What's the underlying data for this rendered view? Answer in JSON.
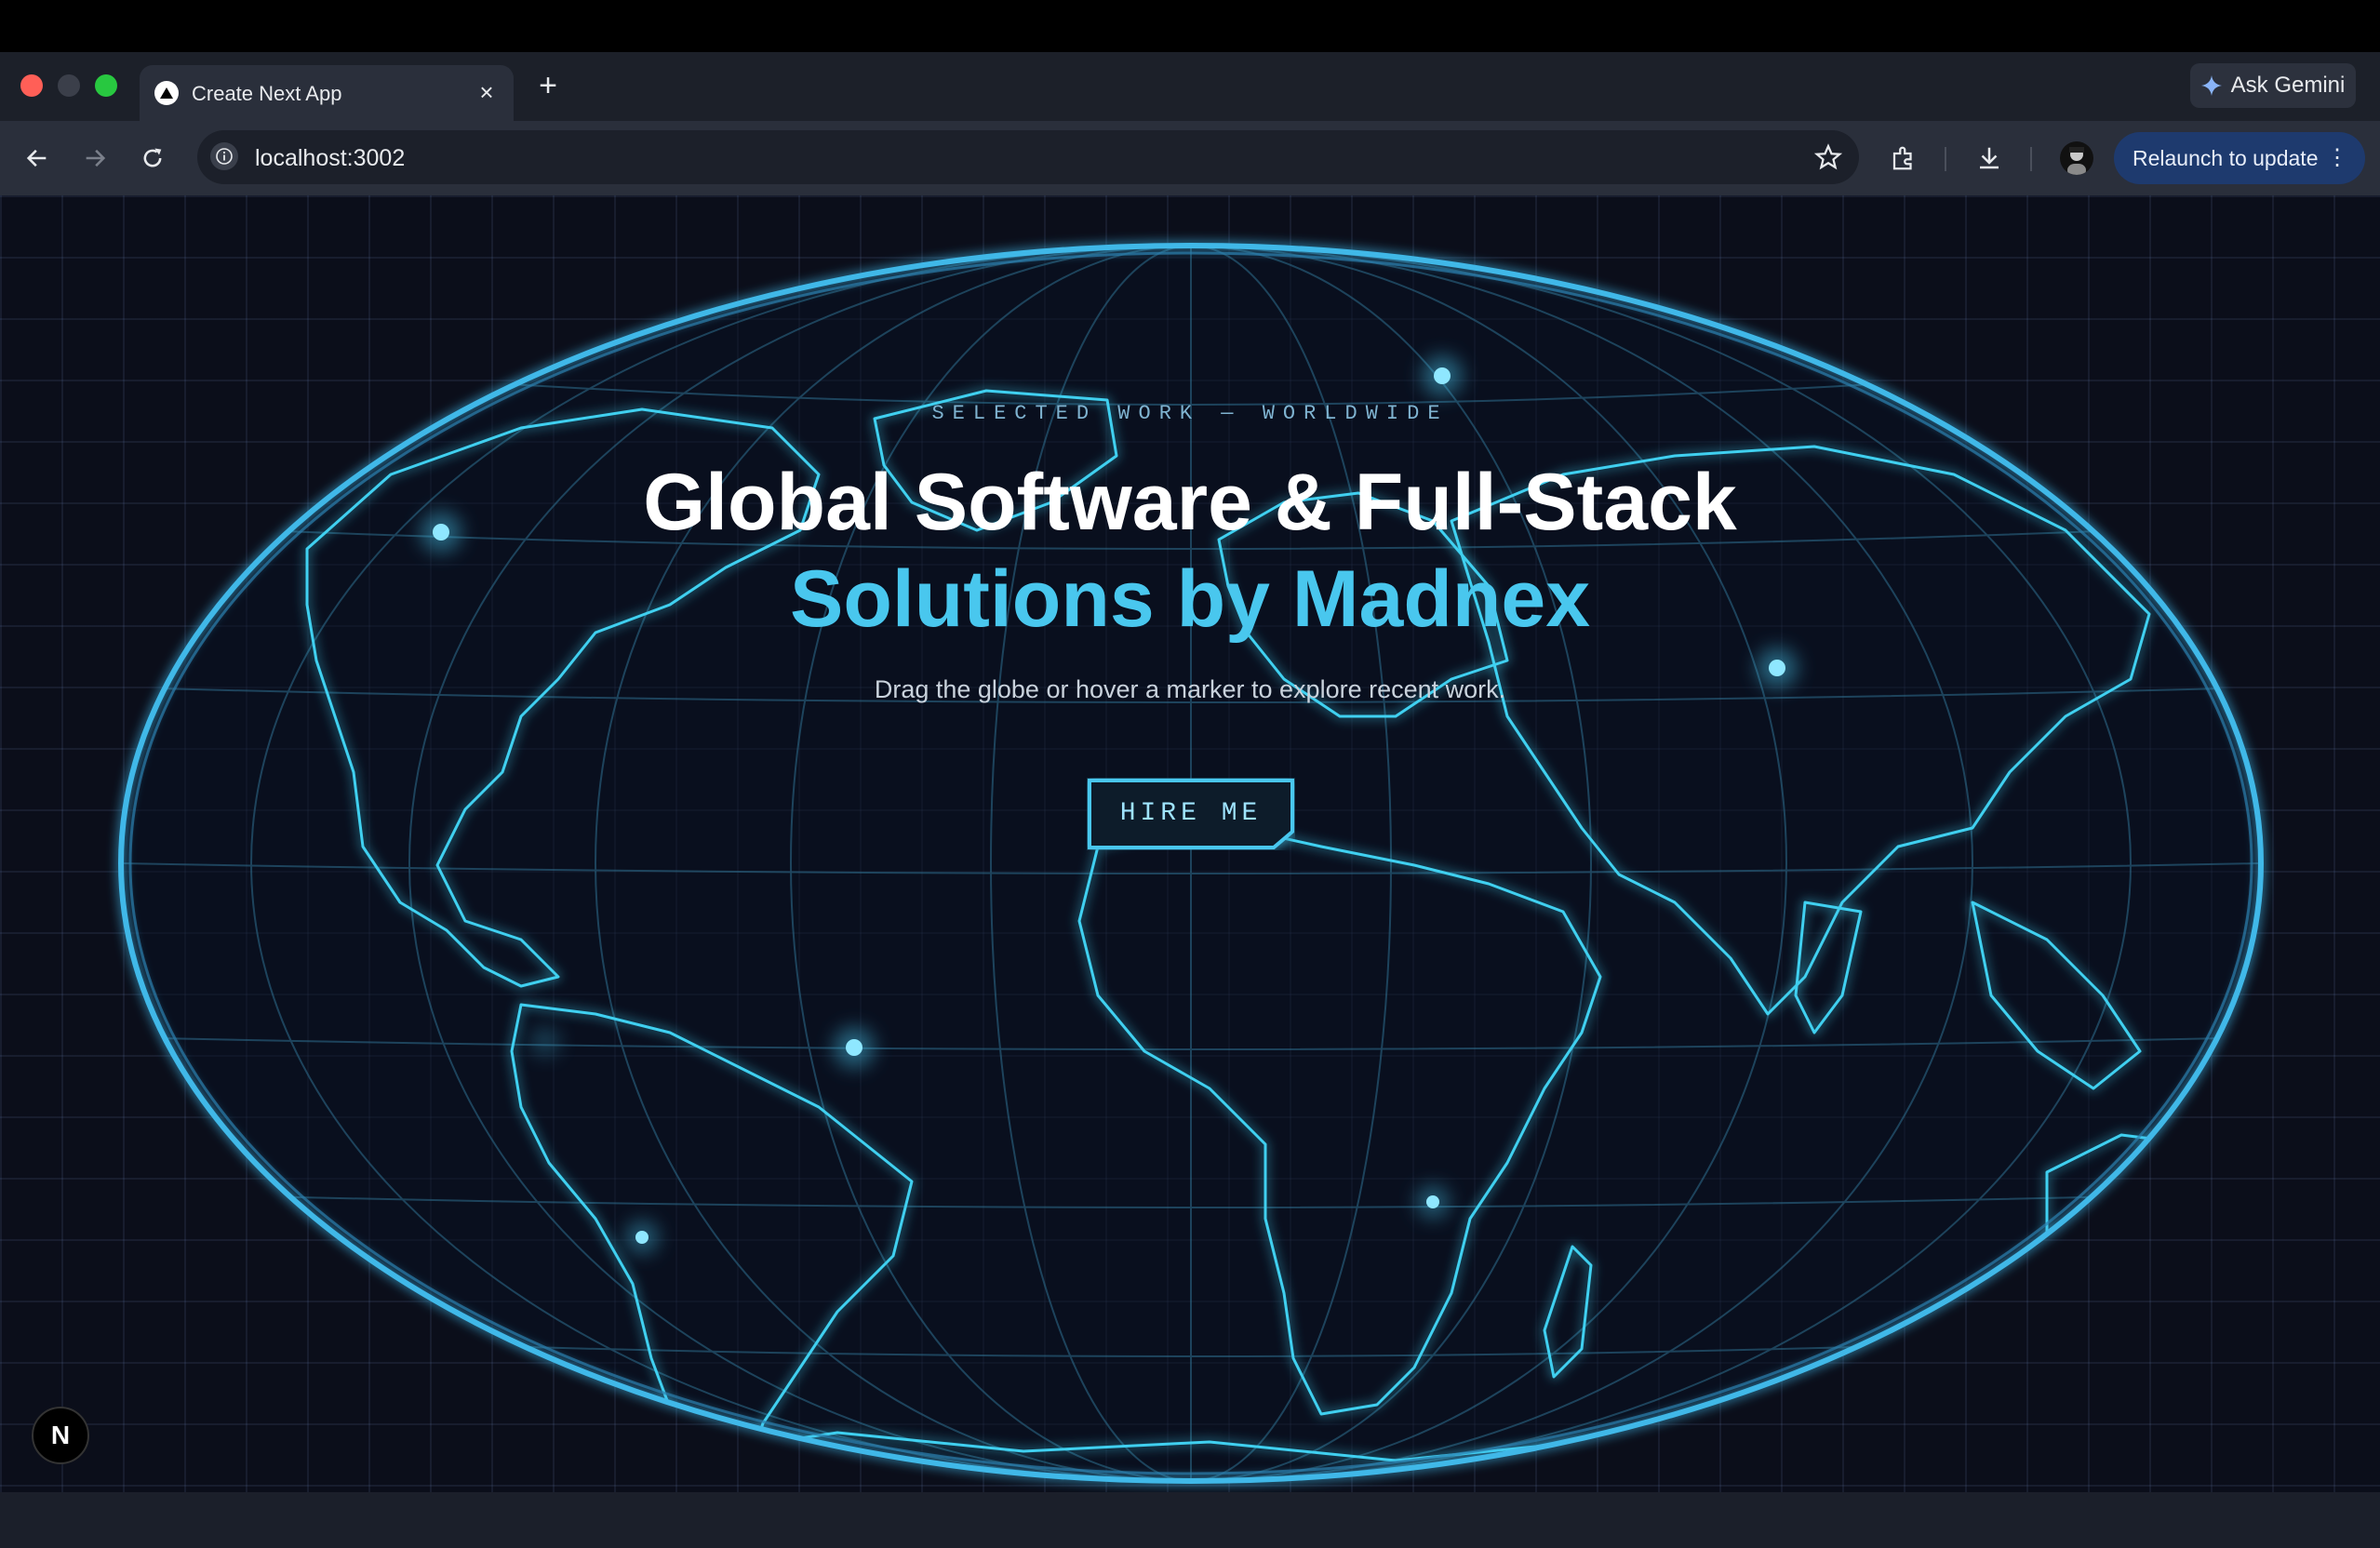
{
  "browser": {
    "tab_title": "Create Next App",
    "tab_close_glyph": "×",
    "new_tab_glyph": "+",
    "ask_gemini_label": "Ask Gemini",
    "url": "localhost:3002",
    "relaunch_label": "Relaunch to update",
    "relaunch_menu_glyph": "⋮",
    "icons": [
      "back-icon",
      "forward-icon",
      "reload-icon",
      "site-info-icon",
      "bookmark-star-icon",
      "extensions-icon",
      "download-icon",
      "profile-avatar",
      "gemini-sparkle-icon"
    ]
  },
  "hero": {
    "eyebrow": "SELECTED WORK — WORLDWIDE",
    "headline_line1": "Global Software & Full-Stack",
    "headline_line2": "Solutions by Madnex",
    "subtitle": "Drag the globe or hover a marker to explore recent work.",
    "cta_label": "HIRE ME"
  },
  "next_badge": "N",
  "colors": {
    "background": "#0b0e1a",
    "accent": "#49c7ee",
    "globe_glow": "#3fb8e8",
    "relaunch_button": "#1e3a6e"
  }
}
